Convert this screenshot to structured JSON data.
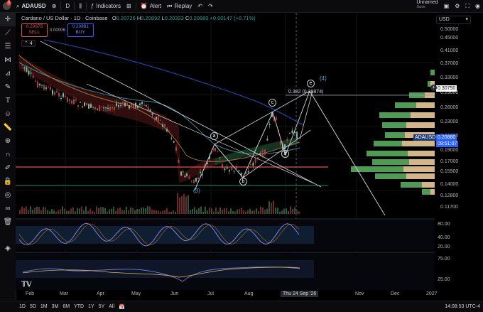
{
  "topbar": {
    "notif_badge": "5",
    "symbol": "ADAUSD",
    "interval": "D",
    "indicators_label": "Indicators",
    "alert_label": "Alert",
    "replay_label": "Replay",
    "layout_name": "Unnamed",
    "layout_status": "Save"
  },
  "legend": {
    "title": "Cardano / US Dollar · 1D · Coinbase",
    "o_label": "O",
    "o": "0.20726",
    "h_label": "H",
    "h": "0.20892",
    "l_label": "L",
    "l": "0.20323",
    "c_label": "C",
    "c": "0.20880",
    "chg": "+0.00147 (+0.71%)",
    "sell_price": "0.20875",
    "sell_label": "SELL",
    "spread": "0.00006",
    "buy_price": "0.20881",
    "buy_label": "BUY",
    "indicator_count": "4"
  },
  "currency": "USD",
  "price_levels": [
    "0.50000",
    "0.45000",
    "0.41000",
    "0.37000",
    "0.33000",
    "0.29000",
    "0.26000",
    "0.23000",
    "0.21000",
    "0.19000",
    "0.17000",
    "0.15500",
    "0.14000",
    "0.12800",
    "0.11700"
  ],
  "price_tags": {
    "top": "0.30750",
    "sym": "ADAUSD",
    "last": "0.20880",
    "countdown": "09:51:07"
  },
  "fib_label": "0.382 (0.28874)",
  "wave_labels": {
    "w4": "(4)",
    "w3": "(3)",
    "a": "a",
    "b": "b",
    "c": "c",
    "d": "d",
    "e": "e"
  },
  "osc1_levels": [
    "80.00",
    "40.00",
    "20.00"
  ],
  "osc2_levels": [
    "75.00",
    "25.00"
  ],
  "time_labels": [
    "Feb",
    "Mar",
    "Apr",
    "May",
    "Jun",
    "Jul",
    "Aug",
    "Sep",
    "Nov",
    "Dec",
    "2027"
  ],
  "crosshair_date": "Thu 24 Sep '26",
  "bottombar": {
    "ranges": [
      "1D",
      "5D",
      "1M",
      "3M",
      "6M",
      "YTD",
      "1Y",
      "5Y",
      "All"
    ],
    "clock": "14:08:53 UTC-4"
  },
  "colors": {
    "up": "#7fb8a0",
    "down": "#b04040",
    "resistance": "#e05050",
    "support": "#2a8c6a",
    "vp_green": "#4f9a55",
    "vp_tan": "#d3b58a"
  }
}
